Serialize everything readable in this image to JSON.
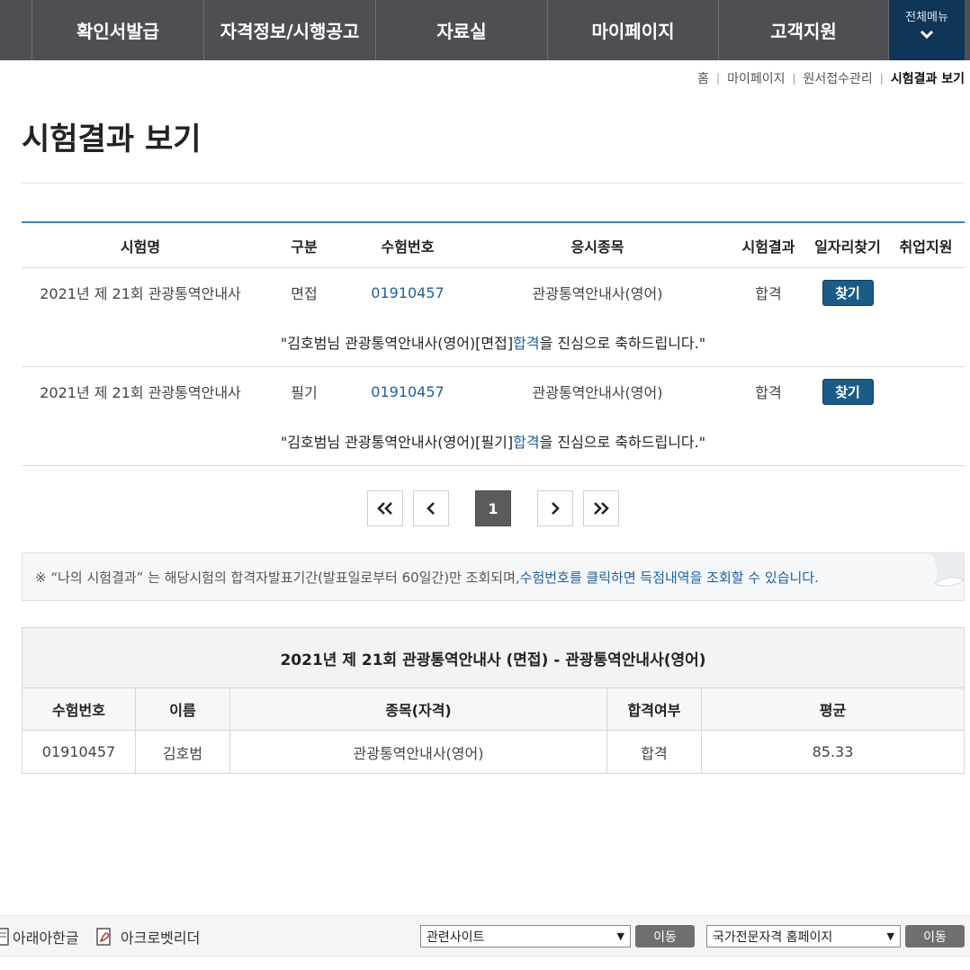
{
  "nav": {
    "items": [
      "확인서발급",
      "자격정보/시행공고",
      "자료실",
      "마이페이지",
      "고객지원"
    ],
    "all_menu": "전체메뉴"
  },
  "breadcrumb": {
    "items": [
      "홈",
      "마이페이지",
      "원서접수관리"
    ],
    "current": "시험결과 보기"
  },
  "page_title": "시험결과 보기",
  "results": {
    "headers": [
      "시험명",
      "구분",
      "수험번호",
      "응시종목",
      "시험결과",
      "일자리찾기",
      "취업지원"
    ],
    "rows": [
      {
        "exam_name": "2021년 제 21회 관광통역안내사",
        "type": "면접",
        "exam_no": "01910457",
        "subject": "관광통역안내사(영어)",
        "result": "합격",
        "find_label": "찾기",
        "support": "",
        "msg_before": "\"김호범님 관광통역안내사(영어)[면접] ",
        "msg_pass": "합격",
        "msg_after": "을 진심으로 축하드립니다.\""
      },
      {
        "exam_name": "2021년 제 21회 관광통역안내사",
        "type": "필기",
        "exam_no": "01910457",
        "subject": "관광통역안내사(영어)",
        "result": "합격",
        "find_label": "찾기",
        "support": "",
        "msg_before": "\"김호범님 관광통역안내사(영어)[필기] ",
        "msg_pass": "합격",
        "msg_after": "을 진심으로 축하드립니다.\""
      }
    ]
  },
  "pager": {
    "current": "1"
  },
  "notice": {
    "text": "※ “나의 시험결과” 는 해당시험의 합격자발표기간(발표일로부터 60일간)만 조회되며, ",
    "highlight": "수험번호를 클릭하면 득점내역을 조회할 수 있습니다."
  },
  "score": {
    "caption": "2021년 제 21회 관광통역안내사 (면접) - 관광통역안내사(영어)",
    "headers": [
      "수험번호",
      "이름",
      "종목(자격)",
      "합격여부",
      "평균"
    ],
    "row": [
      "01910457",
      "김호범",
      "관광통역안내사(영어)",
      "합격",
      "85.33"
    ]
  },
  "footer": {
    "hangul_viewer": "아래아한글",
    "acrobat_reader": "아크로벳리더",
    "related_select": "관련사이트",
    "national_select": "국가전문자격 홈페이지",
    "go_label": "이동"
  }
}
